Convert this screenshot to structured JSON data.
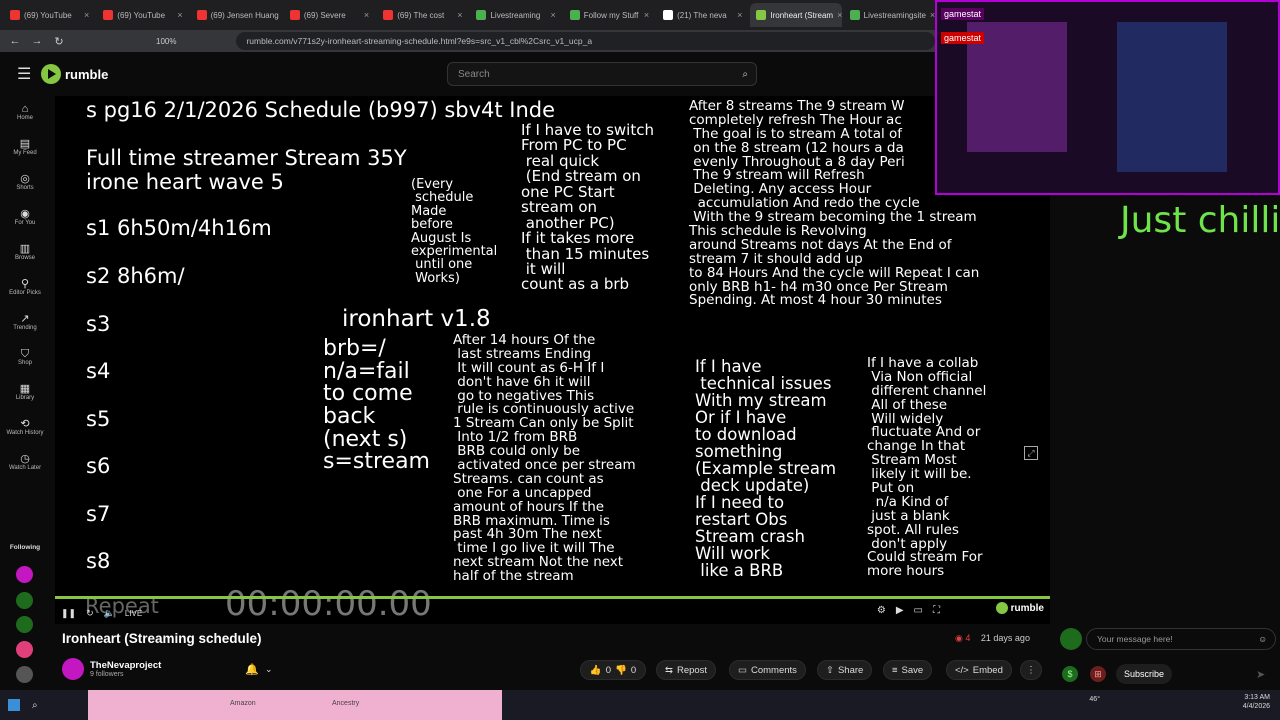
{
  "browser": {
    "tabs": [
      "(69) YouTube",
      "(69) YouTube",
      "(69) Jensen Huang",
      "(69) Severe",
      "(69) The cost",
      "Livestreaming",
      "Follow my Stuff",
      "(21) The neva",
      "Ironheart (Stream",
      "Livestreamingsite"
    ],
    "url": "rumble.com/v771s2y-ironheart-streaming-schedule.html?e9s=src_v1_cbl%2Csrc_v1_ucp_a",
    "zoom": "100%"
  },
  "header": {
    "logo": "rumble",
    "search_placeholder": "Search"
  },
  "sidebar": {
    "items": [
      {
        "label": "Home",
        "icon": "home-icon"
      },
      {
        "label": "My Feed",
        "icon": "feed-icon"
      },
      {
        "label": "Shorts",
        "icon": "shorts-icon"
      },
      {
        "label": "For You",
        "icon": "for-you-icon"
      },
      {
        "label": "Browse",
        "icon": "browse-icon"
      },
      {
        "label": "Editor Picks",
        "icon": "editor-picks-icon"
      },
      {
        "label": "Trending",
        "icon": "trending-icon"
      },
      {
        "label": "Shop",
        "icon": "shop-icon"
      },
      {
        "label": "Library",
        "icon": "library-icon"
      },
      {
        "label": "Watch History",
        "icon": "history-icon"
      },
      {
        "label": "Watch Later",
        "icon": "watch-later-icon"
      }
    ],
    "following": "Following"
  },
  "video": {
    "schedule_header": "s pg16 2/1/2026 Schedule (b997) sbv4t Inde",
    "subtitle1": "Full time streamer Stream 35Y",
    "subtitle2": "irone heart wave 5",
    "slots": [
      "s1 6h50m/4h16m",
      "s2 8h6m/",
      "s3",
      "s4",
      "s5",
      "s6",
      "s7",
      "s8"
    ],
    "experimental": "(Every\n schedule\nMade\nbefore\nAugust Is\nexperimental\n until one\n Works)",
    "version": "ironhart v1.8",
    "legend": "brb=/\nn/a=fail\nto come\nback\n(next s)\ns=stream",
    "switch_note": "If I have to switch\nFrom PC to PC\n real quick\n (End stream on\none PC Start\nstream on\n another PC)\nIf it takes more\n than 15 minutes\n it will\ncount as a brb",
    "brb_rules": "After 14 hours Of the\n last streams Ending\n It will count as 6-H If I\n don't have 6h it will\n go to negatives This\n rule is continuously active\n1 Stream Can only be Split\n Into 1/2 from BRB\n BRB could only be\n activated once per stream\nStreams. can count as\n one For a uncapped\namount of hours If the\nBRB maximum. Time is\npast 4h 30m The next\n time I go live it will The\nnext stream Not the next\nhalf of the stream",
    "refresh_rules": "After 8 streams The 9 stream W\ncompletely refresh The Hour ac\n The goal is to stream A total of\n on the 8 stream (12 hours a da\n evenly Throughout a 8 day Peri\n The 9 stream will Refresh\n Deleting. Any access Hour\n  accumulation And redo the cycle\n With the 9 stream becoming the 1 stream\nThis schedule is Revolving\naround Streams not days At the End of\nstream 7 it should add up\nto 84 Hours And the cycle will Repeat I can\nonly BRB h1- h4 m30 once Per Stream\nSpending. At most 4 hour 30 minutes",
    "tech_issues": "If I have\n technical issues\nWith my stream\nOr if I have\nto download\nsomething\n(Example stream\n deck update)\nIf I need to\nrestart Obs\nStream crash\nWill work\n like a BRB",
    "collab": "If I have a collab\n Via Non official\n different channel\n All of these\n Will widely\n fluctuate And or\nchange In that\n Stream Most\n likely it will be.\n Put on\n  n/a Kind of\n just a blank\nspot. All rules\n don't apply\nCould stream For\nmore hours",
    "timer": "00:00:00.00",
    "repeat_text": "Repeat",
    "live_label": "LIVE",
    "watermark": "rumble"
  },
  "info": {
    "title": "Ironheart (Streaming schedule)",
    "viewers": "4",
    "age": "21 days ago",
    "channel": "TheNevaproject",
    "followers": "9 followers",
    "likes": "0",
    "dislikes": "0",
    "actions": [
      "Repost",
      "Comments",
      "Share",
      "Save",
      "Embed"
    ]
  },
  "stream_overlay": {
    "name_tag": "gamestat",
    "yt_tag": "gamestat",
    "caption": "Just chillin"
  },
  "chat": {
    "placeholder": "Your message here!",
    "subscribe": "Subscribe"
  },
  "taskbar": {
    "items": [
      "Amazon",
      "Ancestry"
    ],
    "time": "3:13 AM",
    "date": "4/4/2026",
    "temp": "46°"
  },
  "colors": {
    "accent": "#85c742",
    "brand_pink": "#c317c1",
    "chill_green": "#6fe34a"
  }
}
